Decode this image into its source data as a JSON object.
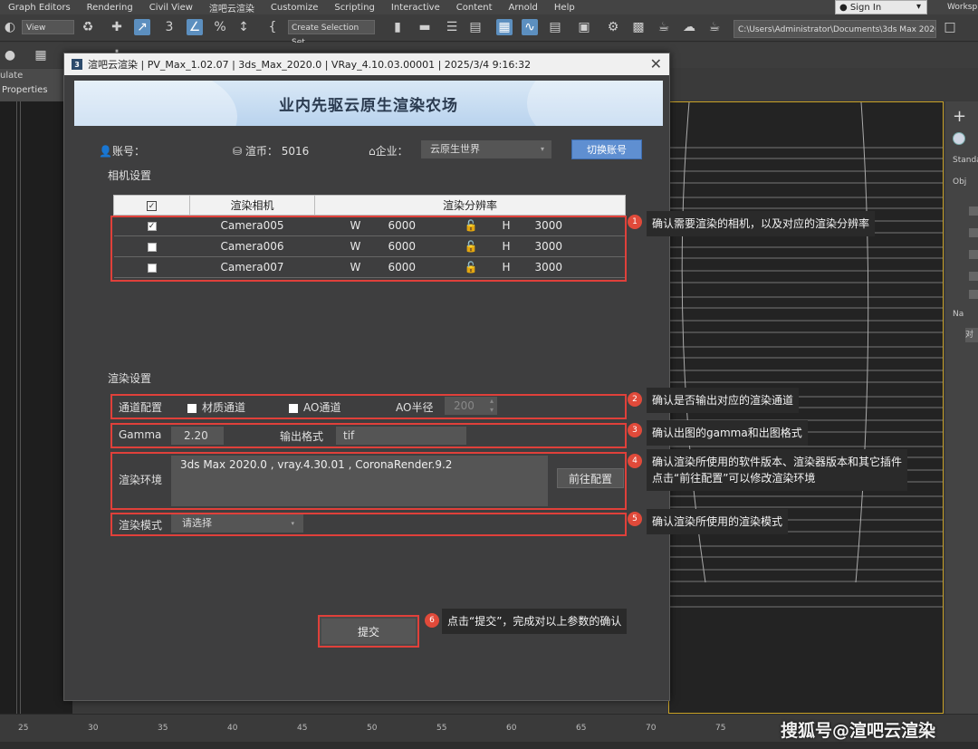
{
  "host": {
    "menu": [
      "Graph Editors",
      "Rendering",
      "Civil View",
      "渲吧云渲染",
      "Customize",
      "Scripting",
      "Interactive",
      "Content",
      "Arnold",
      "Help"
    ],
    "sign_in": "Sign In",
    "workspace": "Worksp",
    "view_dropdown": "View",
    "selection_set": "Create Selection Set",
    "path": "C:\\Users\\Administrator\\Documents\\3ds Max 2020",
    "tab_simulate": "ulate",
    "tab_properties": "Properties",
    "cmd_standard": "Standa",
    "cmd_object": "Obj",
    "cmd_name": "Na",
    "cmd_box": "对",
    "ruler_ticks": [
      "25",
      "30",
      "35",
      "40",
      "45",
      "50",
      "55",
      "60",
      "65",
      "70",
      "75"
    ]
  },
  "watermark": "搜狐号@渲吧云渲染",
  "dialog": {
    "title": "渲吧云渲染 | PV_Max_1.02.07 | 3ds_Max_2020.0 | VRay_4.10.03.00001 | 2025/3/4 9:16:32",
    "banner": "业内先驱云原生渲染农场",
    "account_label": "账号：",
    "coins_label": "渲币：",
    "coins_value": "5016",
    "enterprise_label": "企业：",
    "enterprise_value": "云原生世界",
    "switch_account": "切换账号",
    "camera_section": "相机设置",
    "table": {
      "col_camera": "渲染相机",
      "col_resolution": "渲染分辨率",
      "rows": [
        {
          "checked": true,
          "camera": "Camera005",
          "w_label": "W",
          "w": "6000",
          "h_label": "H",
          "h": "3000"
        },
        {
          "checked": false,
          "camera": "Camera006",
          "w_label": "W",
          "w": "6000",
          "h_label": "H",
          "h": "3000"
        },
        {
          "checked": false,
          "camera": "Camera007",
          "w_label": "W",
          "w": "6000",
          "h_label": "H",
          "h": "3000"
        }
      ]
    },
    "render_section": "渲染设置",
    "channel_label": "通道配置",
    "material_channel": "材质通道",
    "ao_channel": "AO通道",
    "ao_radius_label": "AO半径",
    "ao_radius_value": "200",
    "gamma_label": "Gamma",
    "gamma_value": "2.20",
    "output_format_label": "输出格式",
    "output_format_value": "tif",
    "env_label": "渲染环境",
    "env_value": "3ds Max 2020.0 , vray.4.30.01 , CoronaRender.9.2",
    "goto_config": "前往配置",
    "mode_label": "渲染模式",
    "mode_value": "请选择",
    "submit": "提交"
  },
  "callouts": [
    {
      "num": "1",
      "text": "确认需要渲染的相机，以及对应的渲染分辨率"
    },
    {
      "num": "2",
      "text": "确认是否输出对应的渲染通道"
    },
    {
      "num": "3",
      "text": "确认出图的gamma和出图格式"
    },
    {
      "num": "4",
      "line1": "确认渲染所使用的软件版本、渲染器版本和其它插件",
      "line2": "点击“前往配置”可以修改渲染环境"
    },
    {
      "num": "5",
      "text": "确认渲染所使用的渲染模式"
    },
    {
      "num": "6",
      "text": "点击“提交”，完成对以上参数的确认"
    }
  ],
  "colors": {
    "accent_blue": "#5f8fd1",
    "annotation_red": "#e0403a",
    "viewport_border": "#c9a227"
  }
}
